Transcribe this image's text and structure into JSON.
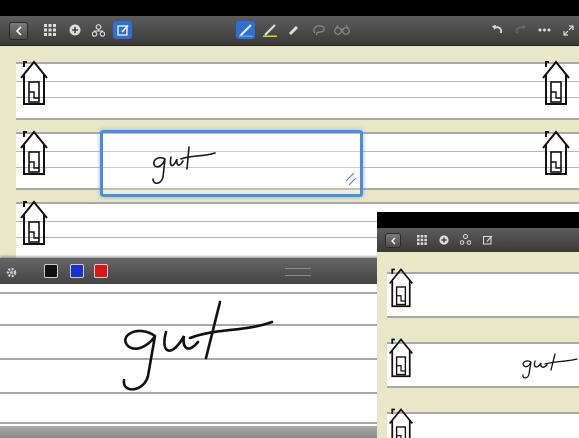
{
  "toolbar": {
    "left_icons": [
      "back-icon",
      "grid-icon",
      "plus-circle-icon",
      "hierarchy-icon",
      "edit-icon"
    ],
    "center_icons": [
      "pen-blue-icon",
      "pen-yellow-icon",
      "eraser-icon",
      "lasso-icon",
      "glasses-icon"
    ],
    "right_icons": [
      "undo-icon",
      "redo-icon",
      "more-icon",
      "expand-icon"
    ]
  },
  "main": {
    "handwriting": "gut",
    "selected_tool": "pen-blue"
  },
  "panel": {
    "colors": [
      "#111111",
      "#1a2fd0",
      "#d81818"
    ],
    "handwriting": "gut"
  },
  "inset": {
    "handwriting": "gut"
  },
  "colors": {
    "accent": "#2e6fd0",
    "focus": "#4d8be0",
    "paper": "#e8e7c8"
  }
}
